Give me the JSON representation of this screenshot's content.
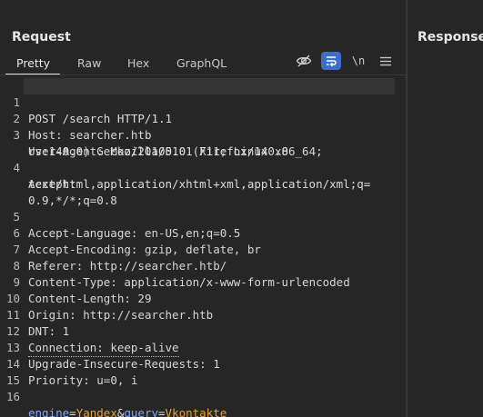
{
  "request": {
    "title": "Request",
    "tabs": [
      "Pretty",
      "Raw",
      "Hex",
      "GraphQL"
    ],
    "active_tab": "Pretty",
    "toolbar": {
      "hide_icon": "eye-slash-icon",
      "wrap_icon": "wrap-lines-icon",
      "newline_label": "\\n",
      "menu_icon": "hamburger-menu-icon"
    },
    "lines": [
      {
        "n": "1",
        "text": "POST /search HTTP/1.1"
      },
      {
        "n": "2",
        "name": "Host",
        "value": "searcher.htb"
      },
      {
        "n": "3",
        "name": "User-Agent",
        "value": "Mozilla/5.0 (X11; Linux x86_64;"
      },
      {
        "n": "",
        "text": "rv:140.0) Gecko/20100101 Firefox/140.0"
      },
      {
        "n": "4",
        "name": "Accept",
        "value": ""
      },
      {
        "n": "",
        "text": "text/html,application/xhtml+xml,application/xml;q="
      },
      {
        "n": "",
        "text": "0.9,*/*;q=0.8"
      },
      {
        "n": "5",
        "name": "Accept-Language",
        "value": "en-US,en;q=0.5"
      },
      {
        "n": "6",
        "name": "Accept-Encoding",
        "value": "gzip, deflate, br"
      },
      {
        "n": "7",
        "name": "Referer",
        "value": "http://searcher.htb/"
      },
      {
        "n": "8",
        "name": "Content-Type",
        "value": "application/x-www-form-urlencoded"
      },
      {
        "n": "9",
        "name": "Content-Length",
        "value": "29"
      },
      {
        "n": "10",
        "name": "Origin",
        "value": "http://searcher.htb"
      },
      {
        "n": "11",
        "name": "DNT",
        "value": "1"
      },
      {
        "n": "12",
        "name": "Connection",
        "value": "keep-alive"
      },
      {
        "n": "13",
        "name": "Upgrade-Insecure-Requests",
        "value": "1"
      },
      {
        "n": "14",
        "name": "Priority",
        "value": "u=0, i"
      },
      {
        "n": "15",
        "text": ""
      },
      {
        "n": "16",
        "body": [
          {
            "key": "engine",
            "value": "Yandex"
          },
          {
            "key": "query",
            "value": "Vkontakte"
          }
        ]
      }
    ]
  },
  "response": {
    "title": "Response"
  },
  "colors": {
    "background": "#262626",
    "param_key": "#7fa8ff",
    "param_value": "#e8a03c",
    "wrap_active": "#3d6fc6"
  }
}
